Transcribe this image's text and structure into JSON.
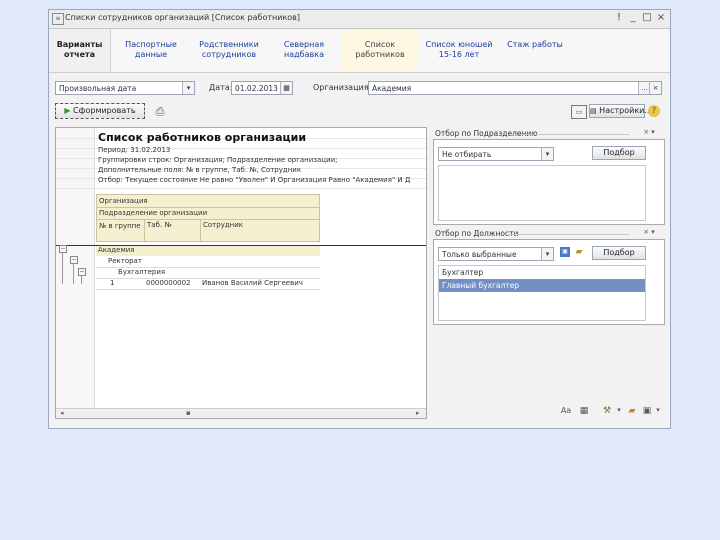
{
  "window": {
    "title": "Списки сотрудников организаций [Список работников]",
    "controls": [
      "!",
      "_",
      "□",
      "×"
    ]
  },
  "tabs": [
    {
      "label": "Варианты отчета"
    },
    {
      "label": "Паспортные данные"
    },
    {
      "label": "Родственники сотрудников"
    },
    {
      "label": "Северная надбавка"
    },
    {
      "label": "Список работников"
    },
    {
      "label": "Список юношей 15-16 лет"
    },
    {
      "label": "Стаж работы"
    }
  ],
  "filters": {
    "period_select": "Произвольная дата",
    "date_label": "Дата:",
    "date_value": "01.02.2013",
    "org_label": "Организация:",
    "org_value": "Академия",
    "org_ellipsis": "..."
  },
  "toolbar": {
    "run_label": "Сформировать",
    "settings_label": "Настройки...",
    "print_icon": "printer-icon",
    "help_icon": "help-icon"
  },
  "report": {
    "title": "Список работников организации",
    "lines": [
      "Период: 31.02.2013",
      "Группировки строк: Организация; Подразделение организации;",
      "Дополнительные поля: № в группе, Таб. №, Сотрудник",
      "Отбор: Текущее состояние Не равно \"Уволен\" И Организация Равно \"Академия\" И Д"
    ],
    "header_org": "Организация",
    "header_dept": "Подразделение организации",
    "header_col1": "№ в группе",
    "header_col2": "Таб. №",
    "header_col3": "Сотрудник",
    "row_org": "Академия",
    "row_dept1": "Ректорат",
    "row_dept2": "Бухгалтерия",
    "row_num": "1",
    "row_tab": "0000000002",
    "row_name": "Иванов Василий Сергеевич"
  },
  "dept_filter": {
    "title": "Отбор по Подразделению",
    "select_value": "Не отбирать",
    "pick_label": "Подбор"
  },
  "pos_filter": {
    "title": "Отбор по Должности",
    "select_value": "Только выбранные",
    "pick_label": "Подбор",
    "items": [
      "Бухгалтер",
      "Главный бухгалтер"
    ],
    "selected_index": 1
  }
}
